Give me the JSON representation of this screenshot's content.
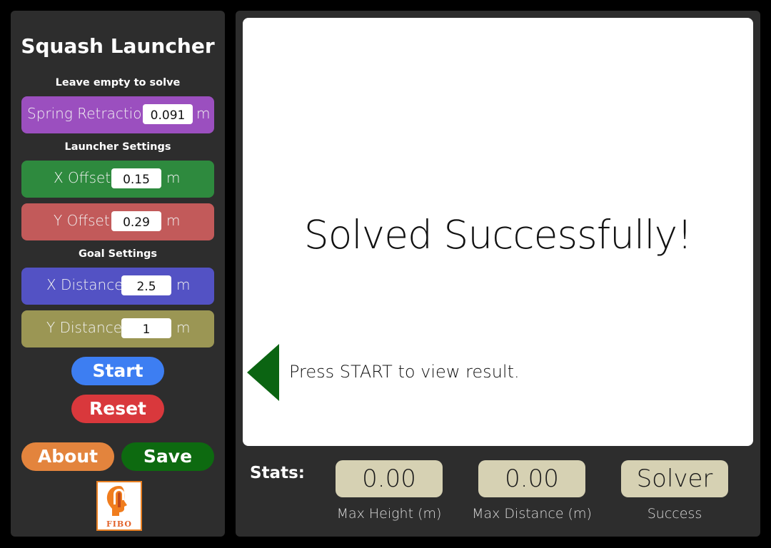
{
  "app": {
    "title": "Squash Launcher"
  },
  "solve_section": {
    "label": "Leave empty to solve",
    "spring_retraction": {
      "label": "Spring Retraction",
      "value": "0.091",
      "unit": "m",
      "color": "#9b4fbf"
    }
  },
  "launcher_section": {
    "label": "Launcher Settings",
    "x_offset": {
      "label": "X Offset",
      "value": "0.15",
      "unit": "m",
      "color": "#2e8a3e"
    },
    "y_offset": {
      "label": "Y Offset",
      "value": "0.29",
      "unit": "m",
      "color": "#c25a5a"
    }
  },
  "goal_section": {
    "label": "Goal Settings",
    "x_distance": {
      "label": "X Distance",
      "value": "2.5",
      "unit": "m",
      "color": "#5352c4"
    },
    "y_distance": {
      "label": "Y Distance",
      "value": "1",
      "unit": "m",
      "color": "#9b9654"
    }
  },
  "buttons": {
    "start": "Start",
    "reset": "Reset",
    "about": "About",
    "save": "Save"
  },
  "logo": {
    "text": "FIBO"
  },
  "display": {
    "message": "Solved Successfully!",
    "hint": "Press START to view result.",
    "arrow_color": "#0b6412",
    "arrow_icon": "left-triangle-icon"
  },
  "stats": {
    "label": "Stats:",
    "max_height": {
      "value": "0.00",
      "caption": "Max Height (m)"
    },
    "max_distance": {
      "value": "0.00",
      "caption": "Max Distance (m)"
    },
    "status": {
      "value": "Solver",
      "caption": "Success"
    }
  }
}
